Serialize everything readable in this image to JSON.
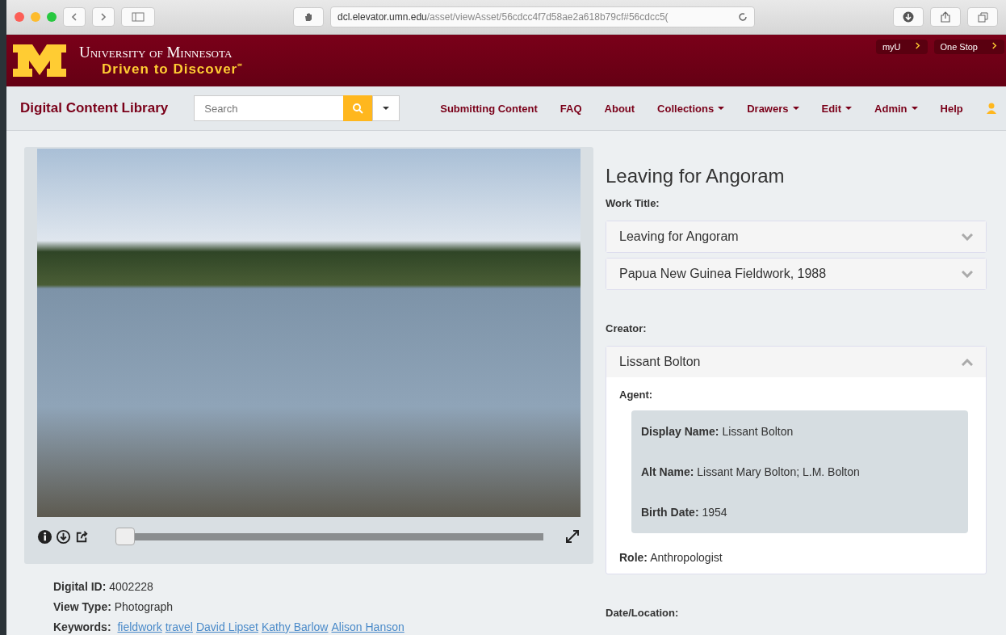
{
  "browser": {
    "url_host": "dcl.elevator.umn.edu",
    "url_path": "/asset/viewAsset/56cdcc4f7d58ae2a618b79cf#56cdcc5("
  },
  "header": {
    "university": "University of Minnesota",
    "tagline": "Driven to Discover",
    "tagline_mark": "℠",
    "links": [
      "myU",
      "One Stop"
    ]
  },
  "navbar": {
    "brand": "Digital Content Library",
    "search": {
      "placeholder": "Search"
    },
    "items": [
      {
        "label": "Submitting Content",
        "dropdown": false
      },
      {
        "label": "FAQ",
        "dropdown": false
      },
      {
        "label": "About",
        "dropdown": false
      },
      {
        "label": "Collections",
        "dropdown": true
      },
      {
        "label": "Drawers",
        "dropdown": true
      },
      {
        "label": "Edit",
        "dropdown": true
      },
      {
        "label": "Admin",
        "dropdown": true
      },
      {
        "label": "Help",
        "dropdown": false
      }
    ]
  },
  "viewer": {
    "zoom": {
      "level": 0
    }
  },
  "details": [
    {
      "label": "Digital ID:",
      "value": "4002228"
    },
    {
      "label": "View Type:",
      "value": "Photograph"
    },
    {
      "label": "Keywords:",
      "links": [
        "fieldwork",
        "travel",
        "David Lipset",
        "Kathy Barlow",
        "Alison Hanson"
      ]
    }
  ],
  "asset_title": "Leaving for Angoram",
  "sections": [
    {
      "label": "Work Title:",
      "panels": [
        {
          "title": "Leaving for Angoram",
          "expanded": false
        },
        {
          "title": "Papua New Guinea Fieldwork, 1988",
          "expanded": false
        }
      ]
    },
    {
      "label": "Creator:",
      "panels": [
        {
          "title": "Lissant Bolton",
          "expanded": true,
          "agent_label": "Agent:",
          "fields": [
            {
              "label": "Display Name:",
              "value": "Lissant Bolton"
            },
            {
              "label": "Alt Name:",
              "value": "Lissant Mary Bolton; L.M. Bolton"
            },
            {
              "label": "Birth Date:",
              "value": "1954"
            }
          ],
          "role": {
            "label": "Role:",
            "value": "Anthropologist"
          }
        }
      ]
    },
    {
      "label": "Date/Location:"
    }
  ]
}
